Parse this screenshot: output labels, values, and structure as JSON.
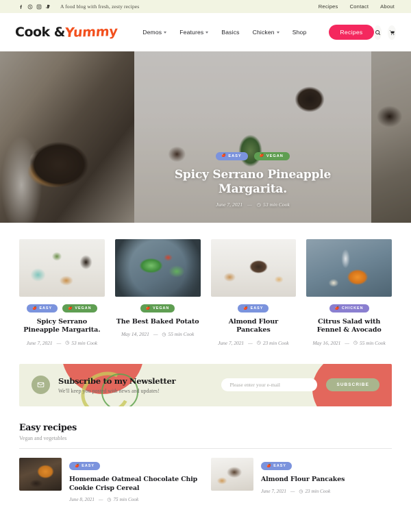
{
  "topbar": {
    "tagline": "A food blog with fresh, zesty recipes",
    "social": [
      {
        "name": "facebook-icon",
        "glyph": "f"
      },
      {
        "name": "pinterest-icon",
        "glyph": "P"
      },
      {
        "name": "instagram-icon",
        "glyph": "O"
      },
      {
        "name": "tiktok-icon",
        "glyph": "d"
      }
    ],
    "links": [
      {
        "label": "Recipes"
      },
      {
        "label": "Contact"
      },
      {
        "label": "About"
      }
    ]
  },
  "header": {
    "logo_primary": "Cook &",
    "logo_accent": "Yummy",
    "nav": [
      {
        "label": "Demos",
        "caret": true
      },
      {
        "label": "Features",
        "caret": true
      },
      {
        "label": "Basics",
        "caret": false
      },
      {
        "label": "Chicken",
        "caret": true
      },
      {
        "label": "Shop",
        "caret": false
      }
    ],
    "cta_label": "Recipes",
    "search_icon": "search-icon",
    "cart_icon": "cart-icon",
    "accent_color": "#f4285e",
    "logo_accent_color": "#f2501e"
  },
  "hero": {
    "tags": [
      {
        "label": "EASY",
        "color": "#7b93dd"
      },
      {
        "label": "VEGAN",
        "color": "#5f9e52"
      }
    ],
    "title": "Spicy Serrano Pineapple Margarita.",
    "date": "June 7, 2021",
    "separator": "—",
    "cook_time": "53 min Cook"
  },
  "cards": [
    {
      "image": "th1",
      "tags": [
        {
          "label": "EASY",
          "color": "#7b93dd"
        },
        {
          "label": "VEGAN",
          "color": "#5f9e52"
        }
      ],
      "title": "Spicy Serrano Pineapple Margarita.",
      "date": "June 7, 2021",
      "separator": "—",
      "cook_time": "53 min Cook"
    },
    {
      "image": "th2",
      "tags": [
        {
          "label": "VEGAN",
          "color": "#5f9e52"
        }
      ],
      "title": "The Best Baked Potato",
      "date": "May 14, 2021",
      "separator": "—",
      "cook_time": "55 min Cook"
    },
    {
      "image": "th3",
      "tags": [
        {
          "label": "EASY",
          "color": "#7b93dd"
        }
      ],
      "title": "Almond Flour Pancakes",
      "date": "June 7, 2021",
      "separator": "—",
      "cook_time": "23 min Cook"
    },
    {
      "image": "th4",
      "tags": [
        {
          "label": "CHICKEN",
          "color": "#8a7fd0"
        }
      ],
      "title": "Citrus Salad with Fennel & Avocado",
      "date": "May 16, 2021",
      "separator": "—",
      "cook_time": "55 min Cook"
    }
  ],
  "newsletter": {
    "icon": "envelope-icon",
    "title": "Subscribe to my Newsletter",
    "subtitle": "We'll keep you posted with news and updates!",
    "email_placeholder": "Please enter your e-mail",
    "email_value": "",
    "button_label": "SUBSCRIBE",
    "background_color": "#eef0e0",
    "button_color": "#a9b58d",
    "blob_color": "#e3675c"
  },
  "easy_recipes": {
    "title": "Easy recipes",
    "subtitle": "Vegan and vegetables",
    "items": [
      {
        "image": "lt1",
        "tags": [
          {
            "label": "EASY",
            "color": "#7b93dd"
          }
        ],
        "title": "Homemade Oatmeal Chocolate Chip Cookie Crisp Cereal",
        "date": "June 8, 2021",
        "separator": "—",
        "cook_time": "75 min Cook"
      },
      {
        "image": "lt2",
        "tags": [
          {
            "label": "EASY",
            "color": "#7b93dd"
          }
        ],
        "title": "Almond Flour Pancakes",
        "date": "June 7, 2021",
        "separator": "—",
        "cook_time": "23 min Cook"
      }
    ]
  }
}
